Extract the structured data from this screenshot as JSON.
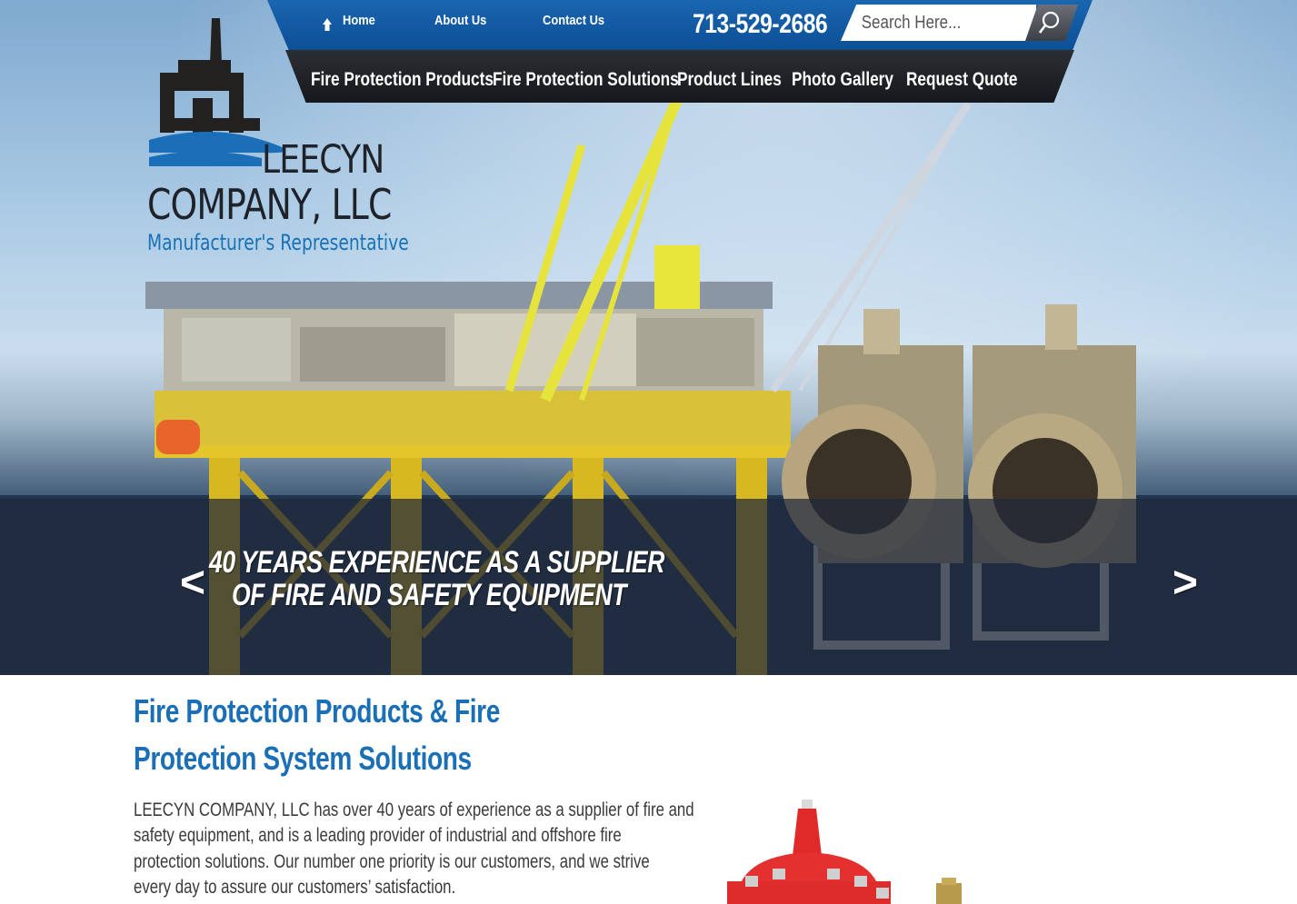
{
  "brand": {
    "line1": "LEECYN",
    "line2": "COMPANY, LLC",
    "tagline": "Manufacturer's Representative"
  },
  "topnav": {
    "home": "Home",
    "about": "About Us",
    "contact": "Contact Us",
    "phone": "713-529-2686",
    "search_placeholder": "Search Here..."
  },
  "mainnav": {
    "items": [
      {
        "label": "Fire Protection Products"
      },
      {
        "label": "Fire Protection Solutions"
      },
      {
        "label": "Product Lines"
      },
      {
        "label": "Photo Gallery"
      },
      {
        "label": "Request Quote"
      }
    ]
  },
  "slider": {
    "line1": "40 YEARS EXPERIENCE AS A SUPPLIER",
    "line2": "OF FIRE AND SAFETY EQUIPMENT",
    "prev": "<",
    "next": ">"
  },
  "content": {
    "heading_line1": "Fire Protection Products & Fire",
    "heading_line2": "Protection System Solutions",
    "body_lines": [
      "LEECYN COMPANY, LLC has over 40 years of experience as a supplier of fire and",
      "safety equipment, and is a leading provider of industrial and offshore fire",
      "protection solutions. Our number one priority is our customers, and we strive",
      "every day to assure our customers’ satisfaction."
    ]
  },
  "colors": {
    "brand_blue": "#1a6fb6",
    "topbar_blue": "#0c4f97",
    "nav_dark": "#1c1f23",
    "body_text": "#3a3a3a"
  }
}
